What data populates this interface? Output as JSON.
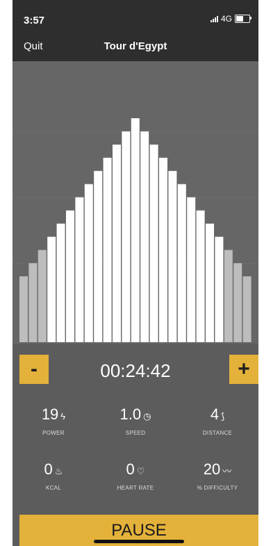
{
  "status_bar": {
    "time": "3:57",
    "network": "4G",
    "battery_level": 0.55
  },
  "nav": {
    "back_label": "Quit",
    "title": "Tour d'Egypt"
  },
  "colors": {
    "accent": "#e4b23a",
    "bar_active": "#ffffff",
    "bar_inactive": "#bdbdbd"
  },
  "chart_data": {
    "type": "bar",
    "values": [
      5,
      6,
      7,
      8,
      9,
      10,
      11,
      12,
      13,
      14,
      15,
      16,
      17,
      16,
      15,
      14,
      13,
      12,
      11,
      10,
      9,
      8,
      7,
      6,
      5
    ],
    "inactive_bars": [
      0,
      1,
      2,
      22,
      23,
      24
    ],
    "ylim": [
      0,
      17
    ]
  },
  "timer": {
    "minus_label": "-",
    "plus_label": "+",
    "elapsed": "00:24:42"
  },
  "stats": [
    {
      "value": "19",
      "icon": "power-icon",
      "glyph": "ϟ",
      "label": "POWER"
    },
    {
      "value": "1.0",
      "icon": "speed-icon",
      "glyph": "◷",
      "label": "SPEED"
    },
    {
      "value": "4",
      "icon": "distance-icon",
      "glyph": "⟆",
      "label": "DISTANCE"
    },
    {
      "value": "0",
      "icon": "flame-icon",
      "glyph": "♨",
      "label": "KCAL"
    },
    {
      "value": "0",
      "icon": "heart-icon",
      "glyph": "♡",
      "label": "HEART RATE"
    },
    {
      "value": "20",
      "icon": "slope-icon",
      "glyph": "〰",
      "label": "% DIFFICULTY"
    }
  ],
  "pause_label": "PAUSE"
}
